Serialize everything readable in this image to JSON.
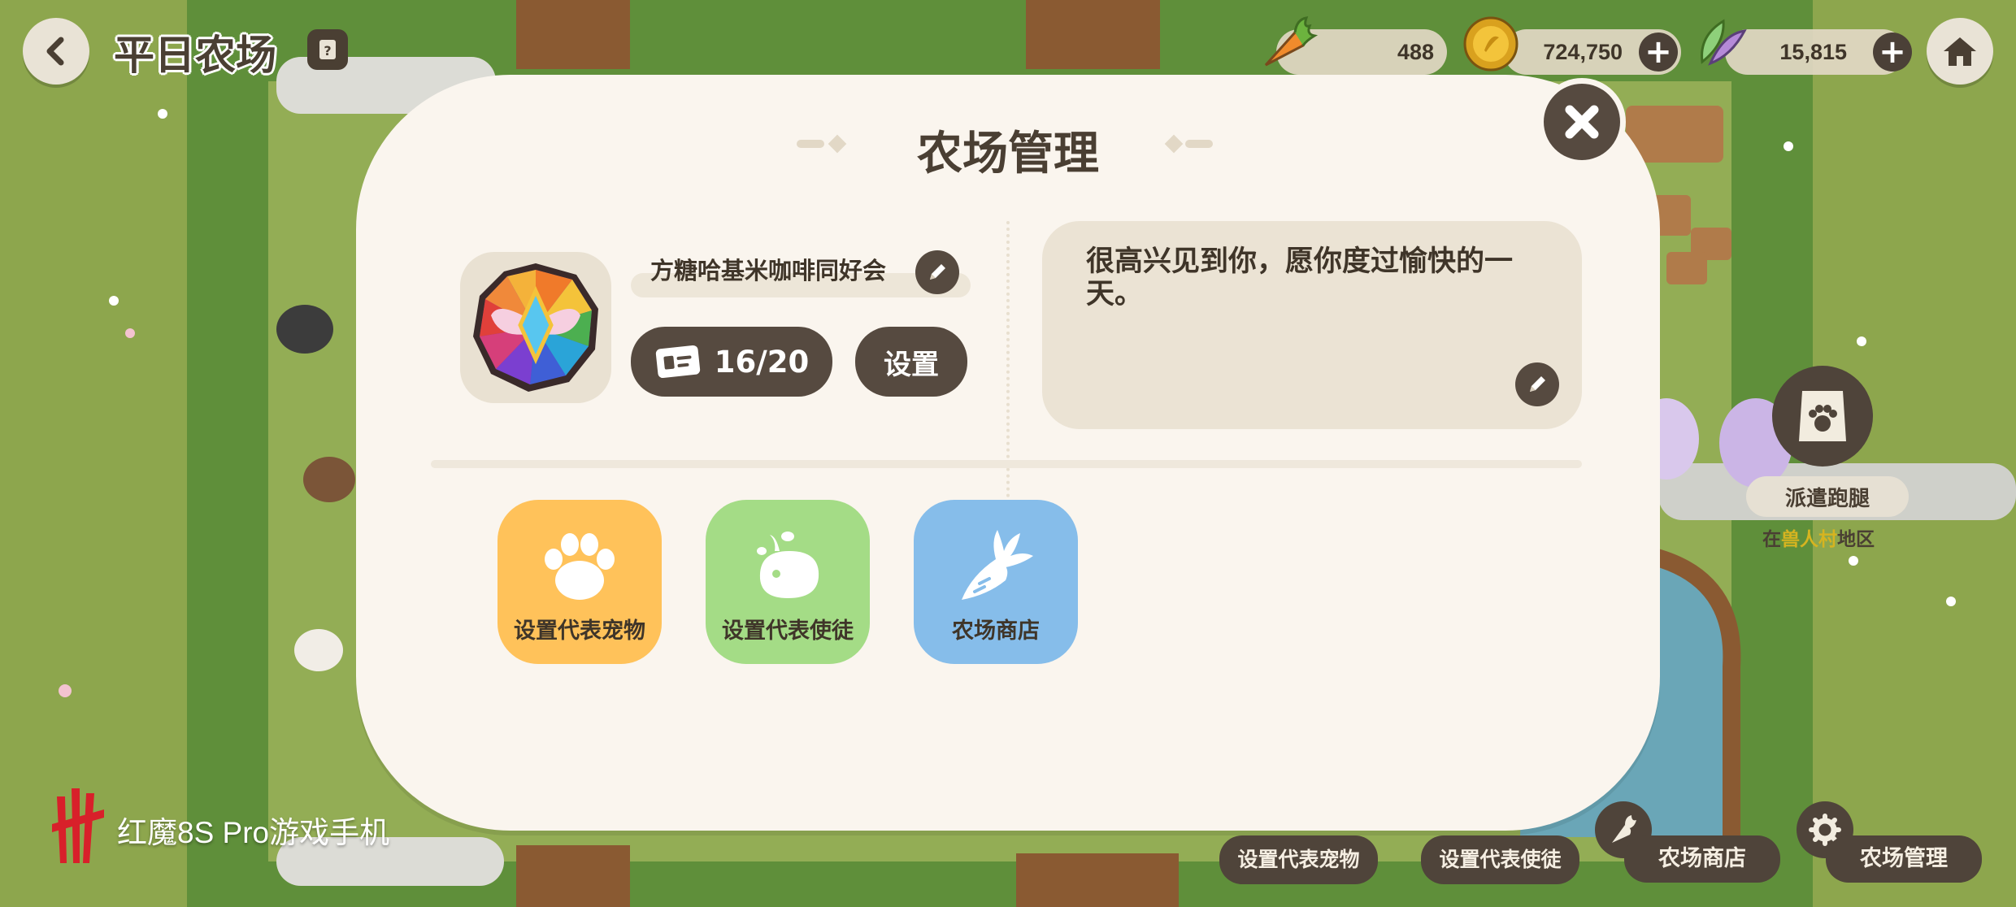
{
  "header": {
    "farm_name": "平日农场",
    "resources": [
      {
        "icon": "carrot-icon",
        "value": "488"
      },
      {
        "icon": "gold-coin-icon",
        "value": "724,750"
      },
      {
        "icon": "gem-leaf-icon",
        "value": "15,815"
      }
    ]
  },
  "modal": {
    "title": "农场管理",
    "owner_name": "方糖哈基米咖啡同好会",
    "visitor_count": "16/20",
    "settings_label": "设置",
    "greeting": "很高兴见到你，愿你度过愉快的一天。",
    "actions": [
      {
        "label": "设置代表宠物",
        "icon": "paw-icon",
        "color": "#ffc25a"
      },
      {
        "label": "设置代表使徒",
        "icon": "sprout-blob-icon",
        "color": "#a4dc86"
      },
      {
        "label": "农场商店",
        "icon": "radish-icon",
        "color": "#86bdea"
      }
    ]
  },
  "map": {
    "dispatch_label": "派遣跑腿",
    "location_prefix": "在",
    "location_highlight": "兽人村",
    "location_suffix": "地区"
  },
  "bottom_bar": {
    "pet_label": "设置代表宠物",
    "apostle_label": "设置代表使徒",
    "shop_label": "农场商店",
    "manage_label": "农场管理"
  },
  "watermark": {
    "text": "红魔8S Pro游戏手机"
  },
  "colors": {
    "modal_bg": "#faf5ee",
    "dark_brown": "#564a40",
    "grass": "#8aa44a"
  }
}
